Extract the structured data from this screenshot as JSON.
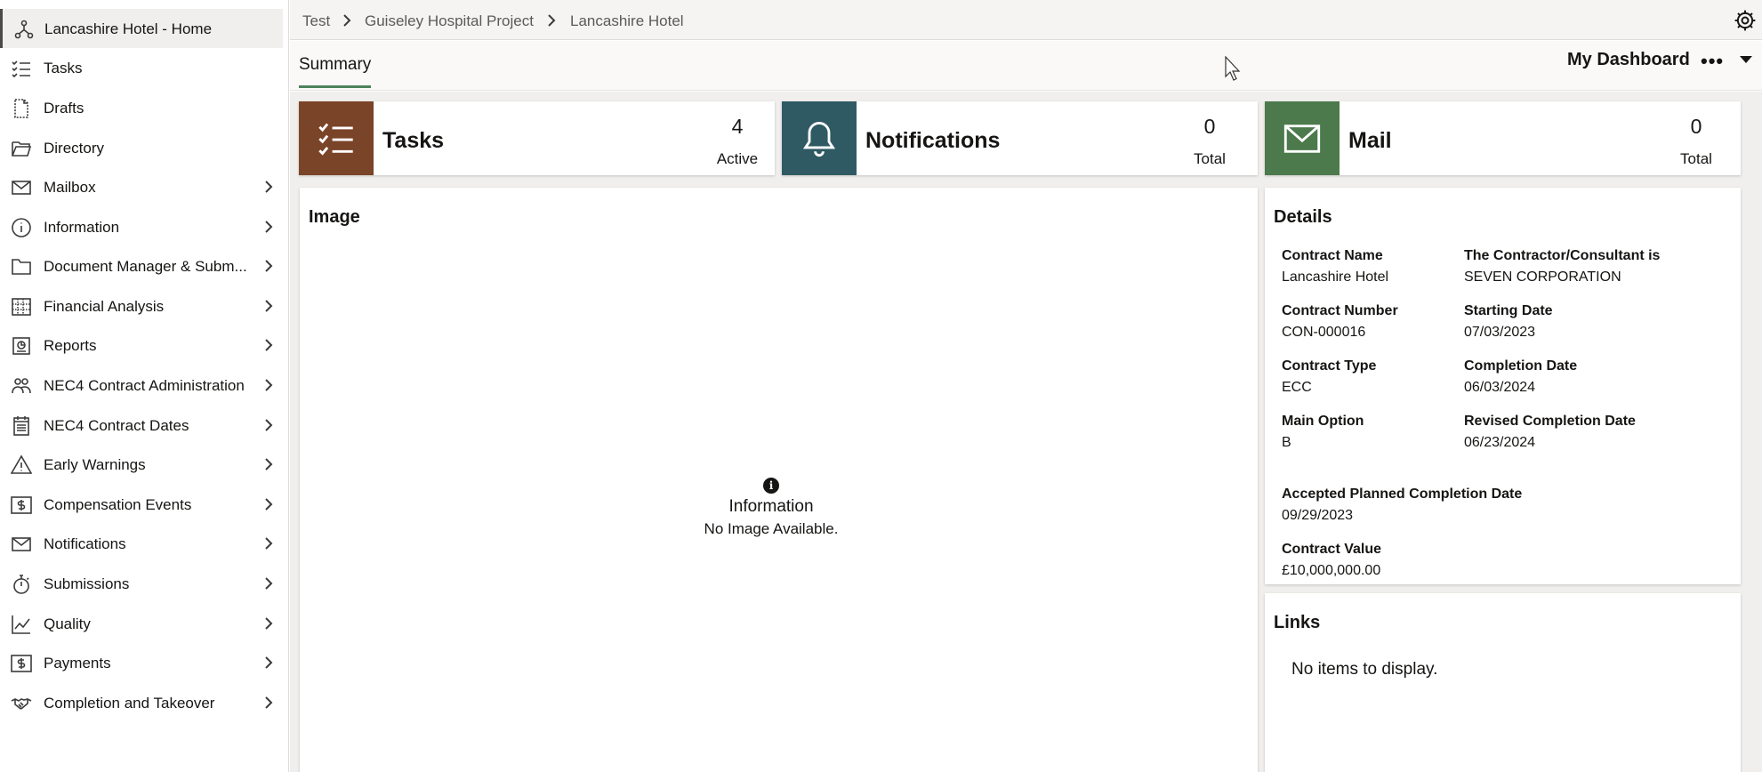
{
  "sidebar": {
    "items": [
      {
        "label": "Lancashire Hotel - Home",
        "icon": "hierarchy-icon",
        "active": true
      },
      {
        "label": "Tasks",
        "icon": "checklist-icon"
      },
      {
        "label": "Drafts",
        "icon": "draft-icon"
      },
      {
        "label": "Directory",
        "icon": "folder-open-icon"
      },
      {
        "label": "Mailbox",
        "icon": "mail-icon"
      },
      {
        "label": "Information",
        "icon": "info-icon"
      },
      {
        "label": "Document Manager & Subm...",
        "icon": "folder-icon"
      },
      {
        "label": "Financial Analysis",
        "icon": "financial-grid-icon"
      },
      {
        "label": "Reports",
        "icon": "report-icon"
      },
      {
        "label": "NEC4 Contract Administration",
        "icon": "people-icon"
      },
      {
        "label": "NEC4 Contract Dates",
        "icon": "calendar-list-icon"
      },
      {
        "label": "Early Warnings",
        "icon": "warning-icon"
      },
      {
        "label": "Compensation Events",
        "icon": "dollar-icon"
      },
      {
        "label": "Notifications",
        "icon": "mail-icon"
      },
      {
        "label": "Submissions",
        "icon": "stopwatch-icon"
      },
      {
        "label": "Quality",
        "icon": "line-chart-icon"
      },
      {
        "label": "Payments",
        "icon": "dollar-icon"
      },
      {
        "label": "Completion and Takeover",
        "icon": "handshake-icon"
      }
    ]
  },
  "breadcrumb": [
    "Test",
    "Guiseley Hospital Project",
    "Lancashire Hotel"
  ],
  "tabs": {
    "summary": "Summary"
  },
  "dashboard": {
    "title": "My Dashboard",
    "more": "•••"
  },
  "tiles": {
    "tasks": {
      "title": "Tasks",
      "count": "4",
      "sub": "Active",
      "color": "#7a4428"
    },
    "notifications": {
      "title": "Notifications",
      "count": "0",
      "sub": "Total",
      "color": "#2f5a64"
    },
    "mail": {
      "title": "Mail",
      "count": "0",
      "sub": "Total",
      "color": "#4c7a4c"
    }
  },
  "image_panel": {
    "title": "Image",
    "info_title": "Information",
    "info_text": "No Image Available."
  },
  "details": {
    "title": "Details",
    "contract_name_label": "Contract Name",
    "contract_name": "Lancashire Hotel",
    "contractor_label": "The Contractor/Consultant is",
    "contractor": "SEVEN CORPORATION",
    "contract_number_label": "Contract Number",
    "contract_number": "CON-000016",
    "starting_date_label": "Starting Date",
    "starting_date": "07/03/2023",
    "contract_type_label": "Contract Type",
    "contract_type": "ECC",
    "completion_date_label": "Completion Date",
    "completion_date": "06/03/2024",
    "main_option_label": "Main Option",
    "main_option": "B",
    "revised_completion_label": "Revised Completion Date",
    "revised_completion": "06/23/2024",
    "accepted_planned_label": "Accepted Planned Completion Date",
    "accepted_planned": "09/29/2023",
    "contract_value_label": "Contract Value",
    "contract_value": "£10,000,000.00"
  },
  "links": {
    "title": "Links",
    "empty": "No items to display."
  }
}
